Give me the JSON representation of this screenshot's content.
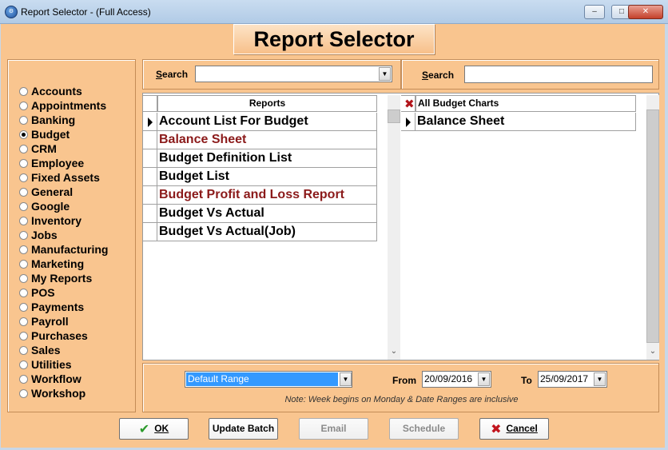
{
  "window": {
    "title": "Report Selector - (Full Access)",
    "minimize_glyph": "–",
    "maximize_glyph": "□",
    "close_glyph": "✕"
  },
  "header": {
    "title": "Report Selector"
  },
  "categories": {
    "items": [
      {
        "label": "Accounts",
        "selected": false
      },
      {
        "label": "Appointments",
        "selected": false
      },
      {
        "label": "Banking",
        "selected": false
      },
      {
        "label": "Budget",
        "selected": true
      },
      {
        "label": "CRM",
        "selected": false
      },
      {
        "label": "Employee",
        "selected": false
      },
      {
        "label": "Fixed Assets",
        "selected": false
      },
      {
        "label": "General",
        "selected": false
      },
      {
        "label": "Google",
        "selected": false
      },
      {
        "label": "Inventory",
        "selected": false
      },
      {
        "label": "Jobs",
        "selected": false
      },
      {
        "label": "Manufacturing",
        "selected": false
      },
      {
        "label": "Marketing",
        "selected": false
      },
      {
        "label": "My Reports",
        "selected": false
      },
      {
        "label": "POS",
        "selected": false
      },
      {
        "label": "Payments",
        "selected": false
      },
      {
        "label": "Payroll",
        "selected": false
      },
      {
        "label": "Purchases",
        "selected": false
      },
      {
        "label": "Sales",
        "selected": false
      },
      {
        "label": "Utilities",
        "selected": false
      },
      {
        "label": "Workflow",
        "selected": false
      },
      {
        "label": "Workshop",
        "selected": false
      }
    ]
  },
  "left_search": {
    "label_first": "S",
    "label_rest": "earch",
    "value": ""
  },
  "right_search": {
    "label_first": "S",
    "label_rest": "earch",
    "value": ""
  },
  "reports_grid": {
    "header": "Reports",
    "rows": [
      {
        "label": "Account List For Budget",
        "color": "#000000",
        "current": true
      },
      {
        "label": "Balance Sheet",
        "color": "#8b1a1a",
        "current": false
      },
      {
        "label": "Budget Definition List",
        "color": "#000000",
        "current": false
      },
      {
        "label": "Budget List",
        "color": "#000000",
        "current": false
      },
      {
        "label": "Budget Profit and Loss Report",
        "color": "#8b1a1a",
        "current": false
      },
      {
        "label": "Budget Vs Actual",
        "color": "#000000",
        "current": false
      },
      {
        "label": "Budget Vs Actual(Job)",
        "color": "#000000",
        "current": false
      }
    ]
  },
  "charts_grid": {
    "header": "All Budget Charts",
    "rows": [
      {
        "label": "Balance Sheet",
        "current": true
      }
    ]
  },
  "range": {
    "selected": "Default Range",
    "from_label": "From",
    "from_date": "20/09/2016",
    "to_label": "To",
    "to_date": "25/09/2017",
    "note": "Note: Week begins on Monday  &  Date Ranges are inclusive"
  },
  "buttons": {
    "ok": "OK",
    "update_batch": "Update Batch",
    "email": "Email",
    "schedule": "Schedule",
    "cancel": "Cancel"
  },
  "colors": {
    "background": "#f9c58f",
    "accent_red": "#8b1a1a",
    "selection_blue": "#3399ff"
  }
}
